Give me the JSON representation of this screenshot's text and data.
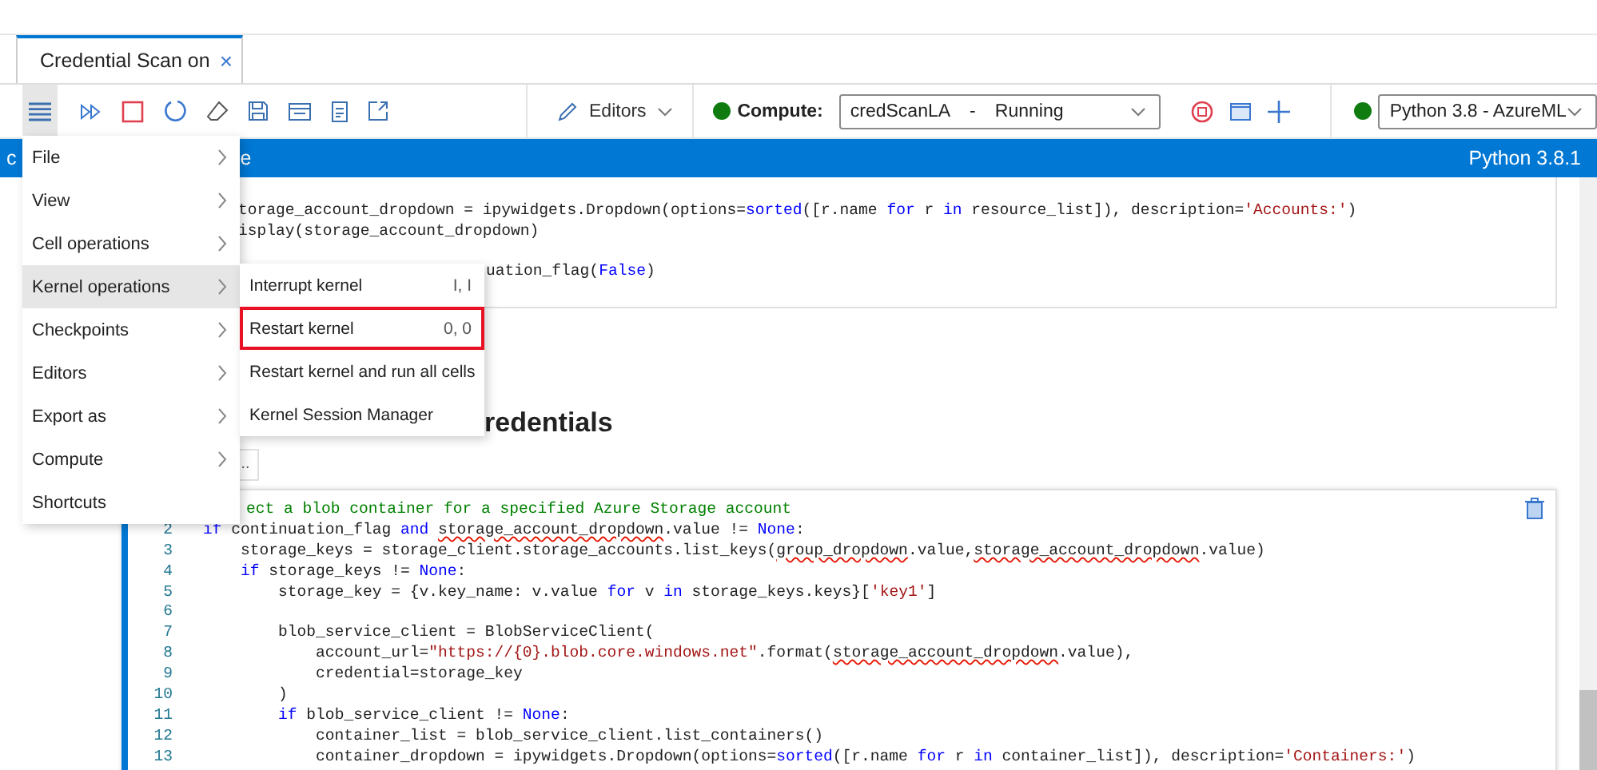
{
  "tab": {
    "title": "Credential Scan on",
    "close": "×",
    "selected": true
  },
  "toolbar": {
    "editors": "Editors",
    "compute_label": "Compute:",
    "compute": {
      "name": "credScanLA",
      "separator": "-",
      "status": "Running",
      "color": "#107c10"
    },
    "kernel": {
      "name": "Python 3.8 - AzureML",
      "color": "#107c10"
    }
  },
  "title_bar": {
    "left": "c",
    "middle": "e",
    "kernel_version": "Python 3.8.1"
  },
  "cell_1": {
    "lines": [
      [
        {
          "text": "torage_account_dropdown = ipywidgets.Dropdown(options=",
          "kind": "plain"
        },
        {
          "text": "sorted",
          "kind": "keyword"
        },
        {
          "text": "([r.name ",
          "kind": "plain"
        },
        {
          "text": "for",
          "kind": "keyword"
        },
        {
          "text": " r ",
          "kind": "plain"
        },
        {
          "text": "in",
          "kind": "keyword"
        },
        {
          "text": " resource_list]), description=",
          "kind": "plain"
        },
        {
          "text": "'Accounts:'",
          "kind": "string"
        },
        {
          "text": ")",
          "kind": "plain"
        }
      ],
      [
        {
          "text": "isplay(storage_account_dropdown)",
          "kind": "plain"
        }
      ],
      [
        {
          "text": "uation_flag(",
          "kind": "plain"
        },
        {
          "text": "False",
          "kind": "keyword"
        },
        {
          "text": ")",
          "kind": "plain"
        }
      ]
    ]
  },
  "heading": {
    "text": "redentials",
    "more": ".."
  },
  "cell_2": {
    "lines": [
      {
        "segments": [
          {
            "text": "ect a blob container for a specified Azure Storage account",
            "kind": "comment"
          }
        ]
      },
      {
        "number": "2",
        "segments": [
          {
            "text": "if",
            "kind": "keyword"
          },
          {
            "text": " continuation_flag ",
            "kind": "plain"
          },
          {
            "text": "and ",
            "kind": "keyword"
          },
          {
            "text": "storage_account_dropdown",
            "kind": "flagged"
          },
          {
            "text": ".value != ",
            "kind": "plain"
          },
          {
            "text": "None",
            "kind": "keyword"
          },
          {
            "text": ":",
            "kind": "plain"
          }
        ]
      },
      {
        "number": "3",
        "segments": [
          {
            "text": "    storage_keys = storage_client.storage_accounts.list_keys(",
            "kind": "plain"
          },
          {
            "text": "group_dropdown",
            "kind": "flagged"
          },
          {
            "text": ".value,",
            "kind": "plain"
          },
          {
            "text": "storage_account_dropdown",
            "kind": "flagged"
          },
          {
            "text": ".value)",
            "kind": "plain"
          }
        ]
      },
      {
        "number": "4",
        "segments": [
          {
            "text": "    if",
            "kind": "keyword"
          },
          {
            "text": " storage_keys != ",
            "kind": "plain"
          },
          {
            "text": "None",
            "kind": "keyword"
          },
          {
            "text": ":",
            "kind": "plain"
          }
        ]
      },
      {
        "number": "5",
        "segments": [
          {
            "text": "        storage_key = {v.key_name: v.value ",
            "kind": "plain"
          },
          {
            "text": "for",
            "kind": "keyword"
          },
          {
            "text": " v ",
            "kind": "plain"
          },
          {
            "text": "in",
            "kind": "keyword"
          },
          {
            "text": " storage_keys.keys}[",
            "kind": "plain"
          },
          {
            "text": "'key1'",
            "kind": "string"
          },
          {
            "text": "]",
            "kind": "plain"
          }
        ]
      },
      {
        "number": "6"
      },
      {
        "number": "7",
        "segments": [
          {
            "text": "        blob_service_client = BlobServiceClient(",
            "kind": "plain"
          }
        ]
      },
      {
        "number": "8",
        "segments": [
          {
            "text": "            account_url=",
            "kind": "plain"
          },
          {
            "text": "\"https://{0}.blob.core.windows.net\"",
            "kind": "string"
          },
          {
            "text": ".format(",
            "kind": "plain"
          },
          {
            "text": "storage_account_dropdown",
            "kind": "flagged"
          },
          {
            "text": ".value),",
            "kind": "plain"
          }
        ]
      },
      {
        "number": "9",
        "segments": [
          {
            "text": "            credential=storage_key",
            "kind": "plain"
          }
        ]
      },
      {
        "number": "10",
        "segments": [
          {
            "text": "        )",
            "kind": "plain"
          }
        ]
      },
      {
        "number": "11",
        "segments": [
          {
            "text": "        if",
            "kind": "keyword"
          },
          {
            "text": " blob_service_client != ",
            "kind": "plain"
          },
          {
            "text": "None",
            "kind": "keyword"
          },
          {
            "text": ":",
            "kind": "plain"
          }
        ]
      },
      {
        "number": "12",
        "segments": [
          {
            "text": "            container_list = blob_service_client.list_containers()",
            "kind": "plain"
          }
        ]
      },
      {
        "number": "13",
        "segments": [
          {
            "text": "            container_dropdown = ipywidgets.Dropdown(options=",
            "kind": "plain"
          },
          {
            "text": "sorted",
            "kind": "keyword"
          },
          {
            "text": "([r.name ",
            "kind": "plain"
          },
          {
            "text": "for",
            "kind": "keyword"
          },
          {
            "text": " r ",
            "kind": "plain"
          },
          {
            "text": "in",
            "kind": "keyword"
          },
          {
            "text": " container_list]), description=",
            "kind": "plain"
          },
          {
            "text": "'Containers:'",
            "kind": "string"
          },
          {
            "text": ")",
            "kind": "plain"
          }
        ]
      }
    ]
  },
  "menu": {
    "open": true,
    "items": [
      {
        "label": "File",
        "selected": false
      },
      {
        "label": "View",
        "selected": false
      },
      {
        "label": "Cell operations",
        "selected": false
      },
      {
        "label": "Kernel operations",
        "selected": true
      },
      {
        "label": "Checkpoints",
        "selected": false
      },
      {
        "label": "Editors",
        "selected": false
      },
      {
        "label": "Export as",
        "selected": false
      },
      {
        "label": "Compute",
        "selected": false
      },
      {
        "label": "Shortcuts",
        "selected": false,
        "submenu": false
      }
    ]
  },
  "submenu": {
    "items": [
      {
        "label": "Interrupt kernel",
        "shortcut": "I, I",
        "highlighted": false
      },
      {
        "label": "Restart kernel",
        "shortcut": "0, 0",
        "highlighted": true
      },
      {
        "label": "Restart kernel and run all cells",
        "highlighted": false
      },
      {
        "label": "Kernel Session Manager",
        "highlighted": false
      }
    ]
  }
}
